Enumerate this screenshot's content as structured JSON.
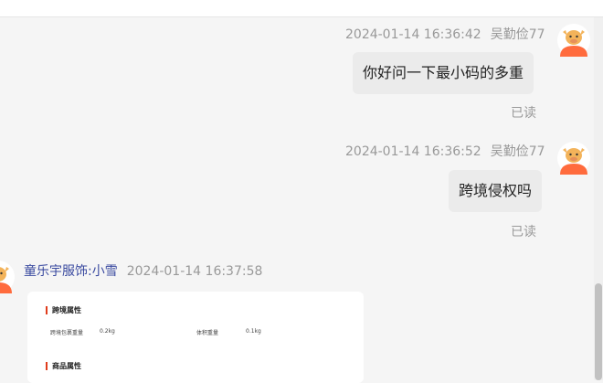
{
  "messages_out": [
    {
      "time": "2024-01-14 16:36:42",
      "sender": "吴勤俭77",
      "text": "你好问一下最小码的多重",
      "status": "已读"
    },
    {
      "time": "2024-01-14 16:36:52",
      "sender": "吴勤俭77",
      "text": "跨境侵权吗",
      "status": "已读"
    }
  ],
  "message_in": {
    "sender": "童乐宇服饰:小雪",
    "time": "2024-01-14 16:37:58",
    "card": {
      "section1": "跨境属性",
      "row1": {
        "k1": "跨境包裹重量",
        "v1": "0.2kg",
        "k2": "体积重量",
        "v2": "0.1kg"
      },
      "section2": "商品属性"
    }
  },
  "colors": {
    "accent": "#e03c1c",
    "seller_name": "#3a4aa0",
    "avatar": "#ff6b3d"
  }
}
